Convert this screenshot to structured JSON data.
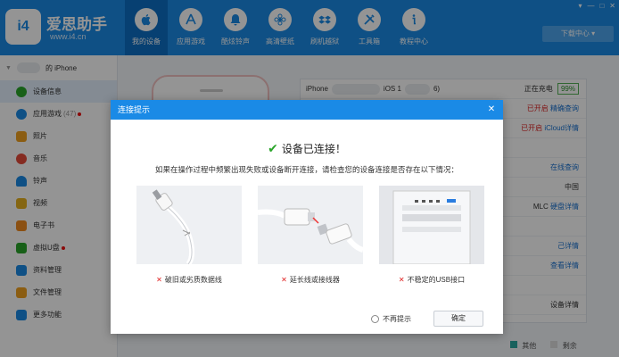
{
  "app": {
    "brand": "爱思助手",
    "url": "www.i4.cn",
    "logo_text": "i4"
  },
  "nav": [
    {
      "label": "我的设备",
      "icon": "apple-icon",
      "active": true
    },
    {
      "label": "应用游戏",
      "icon": "app-store-icon"
    },
    {
      "label": "酷炫铃声",
      "icon": "bell-icon"
    },
    {
      "label": "高清壁纸",
      "icon": "flower-icon"
    },
    {
      "label": "刷机越狱",
      "icon": "dropbox-icon"
    },
    {
      "label": "工具箱",
      "icon": "tools-icon"
    },
    {
      "label": "教程中心",
      "icon": "info-icon"
    }
  ],
  "download_label": "下载中心",
  "sidebar": {
    "device_name": "的 iPhone",
    "items": [
      {
        "label": "设备信息",
        "icon": "info-circle-icon",
        "color": "#2aa52a",
        "active": true
      },
      {
        "label": "应用游戏",
        "count": "(47)",
        "icon": "app-store-icon",
        "color": "#1a8ae6",
        "dot": true
      },
      {
        "label": "照片",
        "icon": "photo-icon",
        "color": "#f0a020"
      },
      {
        "label": "音乐",
        "icon": "music-icon",
        "color": "#e64a3a"
      },
      {
        "label": "铃声",
        "icon": "bell-icon",
        "color": "#1a8ae6"
      },
      {
        "label": "视频",
        "icon": "video-icon",
        "color": "#e6b020"
      },
      {
        "label": "电子书",
        "icon": "book-icon",
        "color": "#f08a20"
      },
      {
        "label": "虚拟U盘",
        "icon": "udisk-icon",
        "color": "#2aa52a",
        "dot": true
      },
      {
        "label": "资料管理",
        "icon": "contacts-icon",
        "color": "#1a8ae6"
      },
      {
        "label": "文件管理",
        "icon": "folder-icon",
        "color": "#f0a020"
      },
      {
        "label": "更多功能",
        "icon": "grid-icon",
        "color": "#1a8ae6"
      }
    ]
  },
  "info": {
    "model_prefix": "iPhone",
    "ios_prefix": "iOS 1",
    "ios_suffix": "6)",
    "charging": "正在充电",
    "battery": "99%",
    "opened": "已开启",
    "precise_query": "精确查询",
    "opened2": "已开启",
    "icloud": "iCloud详情",
    "online_query": "在线查询",
    "region": "中国",
    "flash": "MLC",
    "disk_detail": "硬盘详情",
    "detail1": "己详情",
    "view_detail": "查看详情",
    "device_detail": "设备详情",
    "legend_other": "其他",
    "legend_free": "剩余"
  },
  "dialog": {
    "title": "连接提示",
    "status": "设备已连接！",
    "desc": "如果在操作过程中频繁出现失败或设备断开连接，请检查您的设备连接是否存在以下情况：",
    "tips": [
      {
        "caption": "破旧或劣质数据线"
      },
      {
        "caption": "延长线或接线器"
      },
      {
        "caption": "不稳定的USB接口"
      }
    ],
    "no_remind": "不再提示",
    "ok": "确定"
  }
}
